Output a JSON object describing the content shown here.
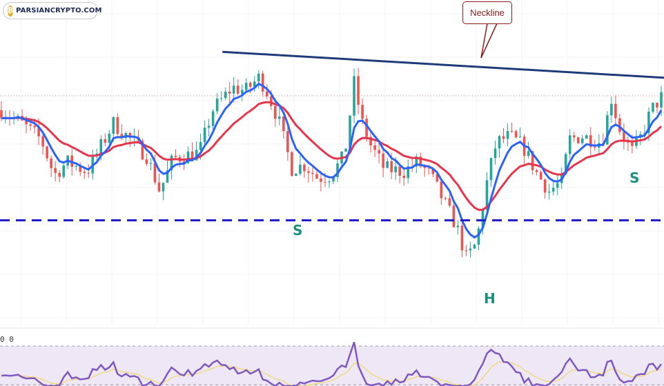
{
  "branding": {
    "logo_text": "PARSIANCRYPTO.COM",
    "logo_icon": "bitcoin-coin-icon"
  },
  "annotations": {
    "neckline_label": "Neckline",
    "left_shoulder": "S",
    "head": "H",
    "right_shoulder": "S"
  },
  "oscillator": {
    "label": "0 0"
  },
  "colors": {
    "up": "#26a69a",
    "down": "#ef5350",
    "fast_ma": "#2962ff",
    "slow_ma": "#e8344a",
    "neckline": "#1e3a78",
    "support": "#1a1acc",
    "osc_line": "#7e57c2",
    "osc_signal": "#f3d34a",
    "osc_band": "#ede7f6",
    "pattern_letters": "#1a8f80",
    "callout": "#8b1a1a"
  },
  "chart_data": {
    "type": "candlestick",
    "pattern": "head-and-shoulders",
    "title": "",
    "xlabel": "",
    "ylabel": "",
    "grid": true,
    "ylim": [
      0,
      100
    ],
    "candles": [],
    "overlays": [
      {
        "name": "",
        "kind": "moving-average",
        "color": "#2962ff"
      },
      {
        "name": "",
        "kind": "moving-average",
        "color": "#e8344a"
      }
    ],
    "neckline": {
      "x": [
        0.335,
        1.0
      ],
      "y": [
        84,
        76
      ]
    },
    "support_level": 32
  }
}
